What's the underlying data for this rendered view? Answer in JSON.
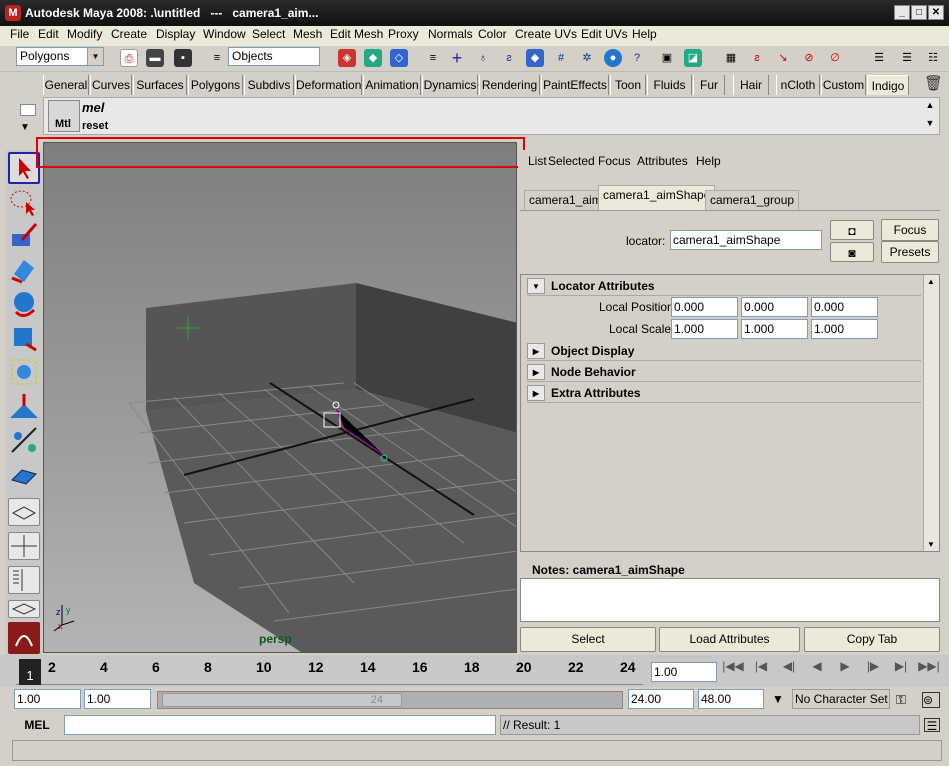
{
  "window": {
    "title": "Autodesk Maya 2008: .\\untitled   ---   camera1_aim..."
  },
  "menu": [
    "File",
    "Edit",
    "Modify",
    "Create",
    "Display",
    "Window",
    "Select",
    "Mesh",
    "Edit Mesh",
    "Proxy",
    "Normals",
    "Color",
    "Create UVs",
    "Edit UVs",
    "Help"
  ],
  "statusline": {
    "menuset": "Polygons",
    "selection_field": "Objects"
  },
  "shelf_tabs": [
    "General",
    "Curves",
    "Surfaces",
    "Polygons",
    "Subdivs",
    "Deformation",
    "Animation",
    "Dynamics",
    "Rendering",
    "PaintEffects",
    "Toon",
    "Fluids",
    "Fur",
    "Hair",
    "nCloth",
    "Custom",
    "Indigo"
  ],
  "shelf": {
    "btn1": "Mtl",
    "btn2_top": "mel",
    "btn2_bottom": "reset"
  },
  "viewport": {
    "camera_label": "persp"
  },
  "attr_editor": {
    "menu": [
      "List",
      "Selected",
      "Focus",
      "Attributes",
      "Help"
    ],
    "tabs": [
      "camera1_aim",
      "camera1_aimShape",
      "camera1_group"
    ],
    "node_label": "locator:",
    "node_value": "camera1_aimShape",
    "focus_btn": "Focus",
    "presets_btn": "Presets",
    "sections": {
      "locator": "Locator Attributes",
      "object_display": "Object Display",
      "node_behavior": "Node Behavior",
      "extra": "Extra Attributes"
    },
    "local_position": {
      "label": "Local Position",
      "x": "0.000",
      "y": "0.000",
      "z": "0.000"
    },
    "local_scale": {
      "label": "Local Scale",
      "x": "1.000",
      "y": "1.000",
      "z": "1.000"
    },
    "notes_label": "Notes:  camera1_aimShape",
    "buttons": {
      "select": "Select",
      "load": "Load Attributes",
      "copy": "Copy Tab"
    }
  },
  "time_slider": {
    "current_frame": "1",
    "ticks": [
      "2",
      "4",
      "6",
      "8",
      "10",
      "12",
      "14",
      "16",
      "18",
      "20",
      "22",
      "24"
    ],
    "current_field": "1.00"
  },
  "range_slider": {
    "start": "1.00",
    "inner_start": "1.00",
    "range_end_label": "24",
    "end": "24.00",
    "anim_end": "48.00",
    "character_set": "No Character Set"
  },
  "command_line": {
    "label": "MEL",
    "result": "// Result: 1"
  }
}
